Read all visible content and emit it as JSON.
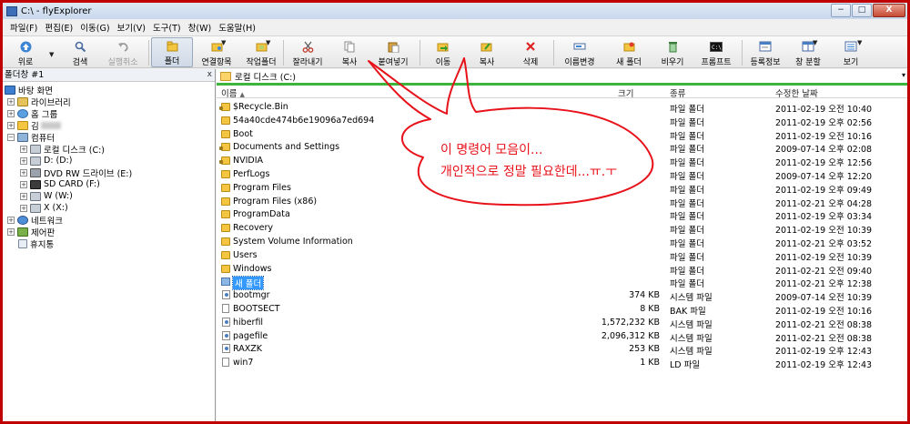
{
  "window": {
    "title": "C:\\ - flyExplorer",
    "min_glyph": "−",
    "max_glyph": "□",
    "close_glyph": "X"
  },
  "menu": [
    "파일(F)",
    "편집(E)",
    "이동(G)",
    "보기(V)",
    "도구(T)",
    "창(W)",
    "도움말(H)"
  ],
  "toolbar": {
    "up": "위로",
    "search": "검색",
    "undo": "실행취소",
    "folder": "폴더",
    "assoc": "연결항목",
    "workfolder": "작업폴더",
    "cut": "잘라내기",
    "copy": "복사",
    "paste": "붙여넣기",
    "move": "이동",
    "copy2": "복사",
    "delete": "삭제",
    "rename": "이름변경",
    "newfolder": "새 폴더",
    "empty": "비우기",
    "prompt": "프롬프트",
    "props": "등록정보",
    "split": "창 분할",
    "view": "보기",
    "drop_glyph": "▼"
  },
  "tree": {
    "panel_title": "폴더창 #1",
    "close_glyph": "x",
    "expand_glyph": "+",
    "collapse_glyph": "−",
    "items": [
      {
        "label": "바탕 화면"
      },
      {
        "label": "라이브러리"
      },
      {
        "label": "홈 그룹"
      },
      {
        "label": "김"
      },
      {
        "label": "컴퓨터"
      },
      {
        "label": "로컬 디스크 (C:)"
      },
      {
        "label": "D: (D:)"
      },
      {
        "label": "DVD RW 드라이브 (E:)"
      },
      {
        "label": "SD CARD (F:)"
      },
      {
        "label": "W (W:)"
      },
      {
        "label": "X (X:)"
      },
      {
        "label": "네트워크"
      },
      {
        "label": "제어판"
      },
      {
        "label": "휴지통"
      }
    ]
  },
  "address": {
    "path": "로컬 디스크 (C:)",
    "drop_glyph": "▾"
  },
  "columns": {
    "name": "이름",
    "sort_glyph": "▲",
    "size": "크기",
    "type": "종류",
    "modified": "수정한 날짜"
  },
  "files": [
    {
      "name": "$Recycle.Bin",
      "size": "",
      "type": "파일 폴더",
      "date": "2011-02-19 오전 10:40"
    },
    {
      "name": "54a40cde474b6e19096a7ed694",
      "size": "",
      "type": "파일 폴더",
      "date": "2011-02-19 오후 02:56"
    },
    {
      "name": "Boot",
      "size": "",
      "type": "파일 폴더",
      "date": "2011-02-19 오전 10:16"
    },
    {
      "name": "Documents and Settings",
      "size": "",
      "type": "파일 폴더",
      "date": "2009-07-14 오후 02:08"
    },
    {
      "name": "NVIDIA",
      "size": "",
      "type": "파일 폴더",
      "date": "2011-02-19 오후 12:56"
    },
    {
      "name": "PerfLogs",
      "size": "",
      "type": "파일 폴더",
      "date": "2009-07-14 오후 12:20"
    },
    {
      "name": "Program Files",
      "size": "",
      "type": "파일 폴더",
      "date": "2011-02-19 오후 09:49"
    },
    {
      "name": "Program Files (x86)",
      "size": "",
      "type": "파일 폴더",
      "date": "2011-02-21 오후 04:28"
    },
    {
      "name": "ProgramData",
      "size": "",
      "type": "파일 폴더",
      "date": "2011-02-19 오후 03:34"
    },
    {
      "name": "Recovery",
      "size": "",
      "type": "파일 폴더",
      "date": "2011-02-19 오전 10:39"
    },
    {
      "name": "System Volume Information",
      "size": "",
      "type": "파일 폴더",
      "date": "2011-02-21 오후 03:52"
    },
    {
      "name": "Users",
      "size": "",
      "type": "파일 폴더",
      "date": "2011-02-19 오전 10:39"
    },
    {
      "name": "Windows",
      "size": "",
      "type": "파일 폴더",
      "date": "2011-02-21 오전 09:40"
    },
    {
      "name": "새 폴더",
      "size": "",
      "type": "파일 폴더",
      "date": "2011-02-21 오후 12:38"
    },
    {
      "name": "bootmgr",
      "size": "374 KB",
      "type": "시스템 파일",
      "date": "2009-07-14 오전 10:39"
    },
    {
      "name": "BOOTSECT",
      "size": "8 KB",
      "type": "BAK 파일",
      "date": "2011-02-19 오전 10:16"
    },
    {
      "name": "hiberfil",
      "size": "1,572,232 KB",
      "type": "시스템 파일",
      "date": "2011-02-21 오전 08:38"
    },
    {
      "name": "pagefile",
      "size": "2,096,312 KB",
      "type": "시스템 파일",
      "date": "2011-02-21 오전 08:38"
    },
    {
      "name": "RAXZK",
      "size": "253 KB",
      "type": "시스템 파일",
      "date": "2011-02-19 오후 12:43"
    },
    {
      "name": "win7",
      "size": "1 KB",
      "type": "LD 파일",
      "date": "2011-02-19 오후 12:43"
    }
  ],
  "annotation": {
    "line1": "이 명령어 모음이...",
    "line2": "개인적으로 정말 필요한데...ㅠ.ㅜ",
    "color": "#e8121b"
  },
  "colors": {
    "address_underline": "#3cb53c",
    "selection": "#3399ff",
    "frame": "#c00000"
  }
}
